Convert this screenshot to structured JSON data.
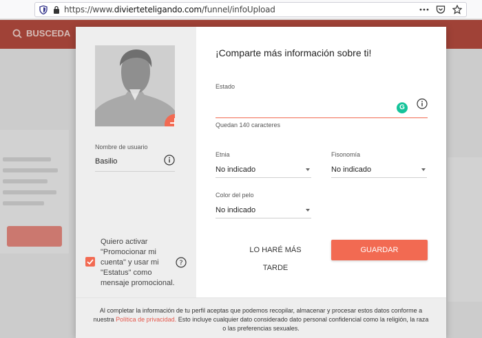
{
  "browser": {
    "url_prefix": "https://www.",
    "url_domain": "divierteteligando.com",
    "url_path": "/funnel/infoUpload",
    "actions": [
      "more-icon",
      "pocket-icon",
      "star-icon"
    ]
  },
  "background": {
    "search_label": "BUSCEDA"
  },
  "left_panel": {
    "username_label": "Nombre de usuario",
    "username_value": "Basilio",
    "promo_text": "Quiero activar \"Promocionar mi cuenta\" y usar mi \"Estatus\" como mensaje promocional.",
    "promo_checked": true
  },
  "right_panel": {
    "title": "¡Comparte más información sobre ti!",
    "estado_label": "Estado",
    "estado_value": "",
    "chars_left": "Quedan 140 caracteres",
    "etnia_label": "Etnia",
    "etnia_value": "No indicado",
    "fisonomia_label": "Fisonomía",
    "fisonomia_value": "No indicado",
    "pelo_label": "Color del pelo",
    "pelo_value": "No indicado",
    "later_label": "LO HARÉ MÁS TARDE",
    "save_label": "GUARDAR"
  },
  "footer": {
    "part1": "Al completar la información de tu perfil aceptas que podemos recopilar, almacenar y procesar estos datos conforme a",
    "part2_prefix": "nuestra",
    "privacy_link": "Política de privacidad.",
    "part2_suffix": "Esto incluye cualquier dato considerado dato personal confidencial como la religión, la raza",
    "part3": "o las preferencias sexuales."
  },
  "colors": {
    "accent": "#f26a52",
    "grammarly": "#15c39a"
  }
}
